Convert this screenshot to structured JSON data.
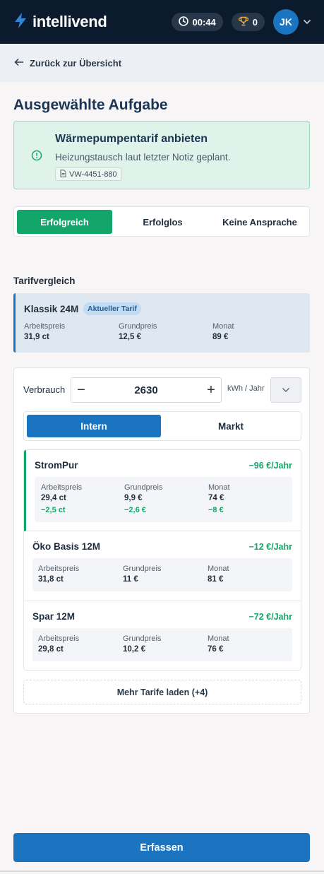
{
  "header": {
    "app_name": "intellivend",
    "timer": "00:44",
    "trophies": "0",
    "user_initials": "JK",
    "colors": {
      "bar": "#0c1a2e",
      "logo_bolt": "#2f86d6",
      "avatar": "#1b74bf"
    },
    "icons": [
      "bolt-logo-icon",
      "clock-icon",
      "trophy-icon",
      "chevron-down-icon"
    ]
  },
  "back": {
    "label": "Zurück zur Übersicht",
    "icon": "arrow-left-icon"
  },
  "page": {
    "title": "Ausgewählte Aufgabe"
  },
  "task": {
    "title": "Wärmepumpentarif anbieten",
    "description": "Heizungstausch laut letzter Notiz geplant.",
    "reference": "VW-4451-880",
    "icons": [
      "info-circle-icon",
      "document-icon"
    ]
  },
  "outcome": {
    "options": [
      "Erfolgreich",
      "Erfolglos",
      "Keine Ansprache"
    ],
    "selected": "Erfolgreich"
  },
  "comparison": {
    "section_title": "Tarifvergleich",
    "current": {
      "name": "Klassik 24M",
      "badge": "Aktueller Tarif",
      "labels": [
        "Arbeitspreis",
        "Grundpreis",
        "Monat"
      ],
      "values": [
        "31,9 ct",
        "12,5 €",
        "89 €"
      ]
    },
    "consumption": {
      "label": "Verbrauch",
      "value": "2630",
      "minus": "−",
      "plus": "+",
      "unit": "kWh / Jahr"
    },
    "source_tabs": [
      "Intern",
      "Markt"
    ],
    "source_selected": "Intern",
    "tariffs": [
      {
        "name": "StromPur",
        "saving": "−96 €/Jahr",
        "labels": [
          "Arbeitspreis",
          "Grundpreis",
          "Monat"
        ],
        "values": [
          "29,4 ct",
          "9,9 €",
          "74 €"
        ],
        "diffs": [
          "−2,5 ct",
          "−2,6 €",
          "−8 €"
        ]
      },
      {
        "name": "Öko Basis 12M",
        "saving": "−12 €/Jahr",
        "labels": [
          "Arbeitspreis",
          "Grundpreis",
          "Monat"
        ],
        "values": [
          "31,8 ct",
          "11 €",
          "81 €"
        ]
      },
      {
        "name": "Spar 12M",
        "saving": "−72 €/Jahr",
        "labels": [
          "Arbeitspreis",
          "Grundpreis",
          "Monat"
        ],
        "values": [
          "29,8 ct",
          "10,2 €",
          "76 €"
        ]
      }
    ],
    "more_label": "Mehr Tarife laden (+4)"
  },
  "actions": {
    "submit": "Erfassen"
  },
  "accent_colors": {
    "success": "#13a66a",
    "primary": "#1b74bf"
  }
}
